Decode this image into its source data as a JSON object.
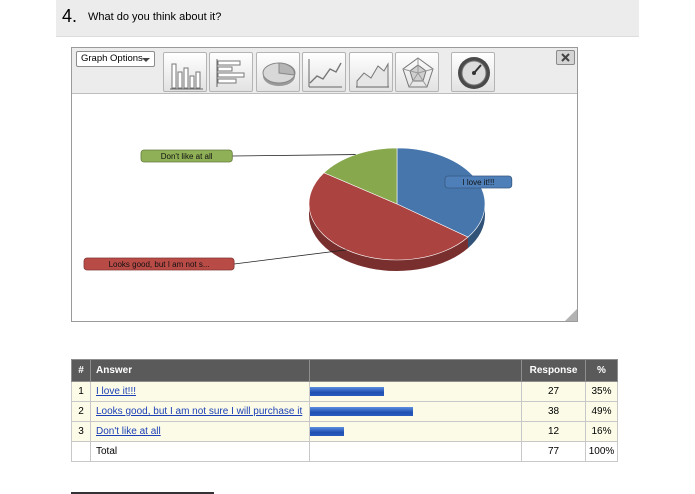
{
  "question": {
    "number": "4.",
    "text": "What do you think about it?"
  },
  "graph": {
    "options_label": "Graph Options",
    "chart_type_buttons": [
      {
        "name": "vertical-bar-chart",
        "icon": "vertical-bar-chart-icon"
      },
      {
        "name": "horizontal-bar-chart",
        "icon": "horizontal-bar-chart-icon"
      },
      {
        "name": "pie-chart",
        "icon": "pie-chart-icon"
      },
      {
        "name": "line-chart",
        "icon": "line-chart-icon"
      },
      {
        "name": "area-chart",
        "icon": "area-chart-icon"
      },
      {
        "name": "radar-chart",
        "icon": "radar-chart-icon"
      },
      {
        "name": "gauge-chart",
        "icon": "gauge-icon"
      }
    ],
    "close_icon": "close-icon"
  },
  "chart_data": {
    "type": "pie",
    "labels": [
      "I love it!!!",
      "Looks good, but I am not sure I will purchase it",
      "Don't like at all"
    ],
    "callout_labels": [
      "I love it!!!",
      "Looks good, but I am not s...",
      "Don't like at all"
    ],
    "values": [
      27,
      38,
      12
    ],
    "percentages": [
      35,
      49,
      16
    ],
    "colors": [
      "#4676ac",
      "#ab4340",
      "#87a84d"
    ],
    "callout_colors": [
      "#4f7fb8",
      "#b94b47",
      "#8fb057"
    ]
  },
  "table": {
    "headers": {
      "num": "#",
      "answer": "Answer",
      "bar": "",
      "response": "Response",
      "percent": "%"
    },
    "rows": [
      {
        "num": "1",
        "answer": "I love it!!!",
        "response": "27",
        "percent": "35%",
        "share": 0.35
      },
      {
        "num": "2",
        "answer": "Looks good, but I am not sure I will purchase it",
        "response": "38",
        "percent": "49%",
        "share": 0.49
      },
      {
        "num": "3",
        "answer": "Don't like at all",
        "response": "12",
        "percent": "16%",
        "share": 0.16
      }
    ],
    "total": {
      "label": "Total",
      "response": "77",
      "percent": "100%"
    }
  }
}
